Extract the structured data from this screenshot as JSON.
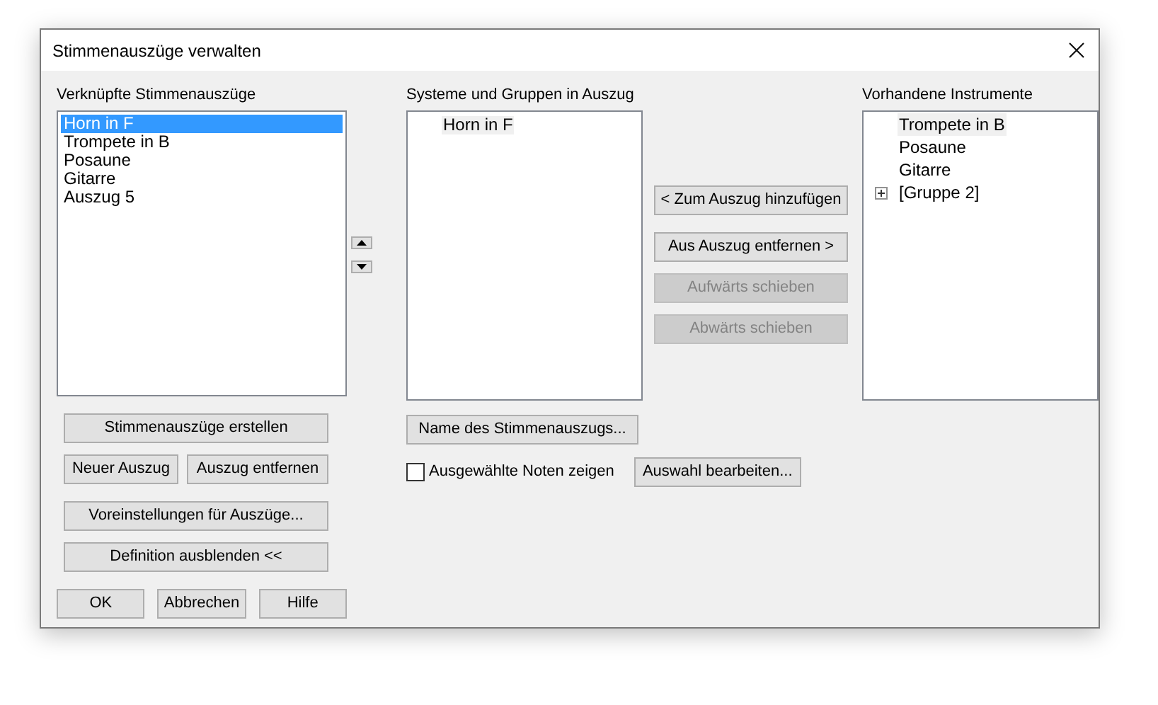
{
  "window": {
    "title": "Stimmenauszüge verwalten"
  },
  "linked_parts": {
    "label": "Verknüpfte Stimmenauszüge",
    "items": [
      {
        "label": "Horn in F",
        "selected": true
      },
      {
        "label": "Trompete in B",
        "selected": false
      },
      {
        "label": "Posaune",
        "selected": false
      },
      {
        "label": "Gitarre",
        "selected": false
      },
      {
        "label": "Auszug 5",
        "selected": false
      }
    ]
  },
  "staves_in_part": {
    "label": "Systeme und Gruppen in Auszug",
    "items": [
      {
        "label": "Horn in F",
        "selected": true
      }
    ]
  },
  "available_instruments": {
    "label": "Vorhandene Instrumente",
    "items": [
      {
        "label": "Trompete in B",
        "selected": true,
        "kind": "item"
      },
      {
        "label": "Posaune",
        "selected": false,
        "kind": "item"
      },
      {
        "label": "Gitarre",
        "selected": false,
        "kind": "item"
      },
      {
        "label": "[Gruppe 2]",
        "selected": false,
        "kind": "group",
        "expanded": false
      }
    ]
  },
  "move_buttons": [
    {
      "label": "< Zum Auszug hinzufügen",
      "disabled": false
    },
    {
      "label": "Aus Auszug entfernen >",
      "disabled": false
    },
    {
      "label": "Aufwärts schieben",
      "disabled": true
    },
    {
      "label": "Abwärts schieben",
      "disabled": true
    }
  ],
  "left_buttons": {
    "create": "Stimmenauszüge erstellen",
    "new": "Neuer Auszug",
    "remove": "Auszug entfernen",
    "preferences": "Voreinstellungen für Auszüge...",
    "hide": "Definition ausblenden <<"
  },
  "name_button": "Name des Stimmenauszugs...",
  "show_selected": {
    "label": "Ausgewählte Noten zeigen",
    "checked": false
  },
  "edit_selection": "Auswahl bearbeiten...",
  "footer_buttons": [
    "OK",
    "Abbrechen",
    "Hilfe"
  ]
}
